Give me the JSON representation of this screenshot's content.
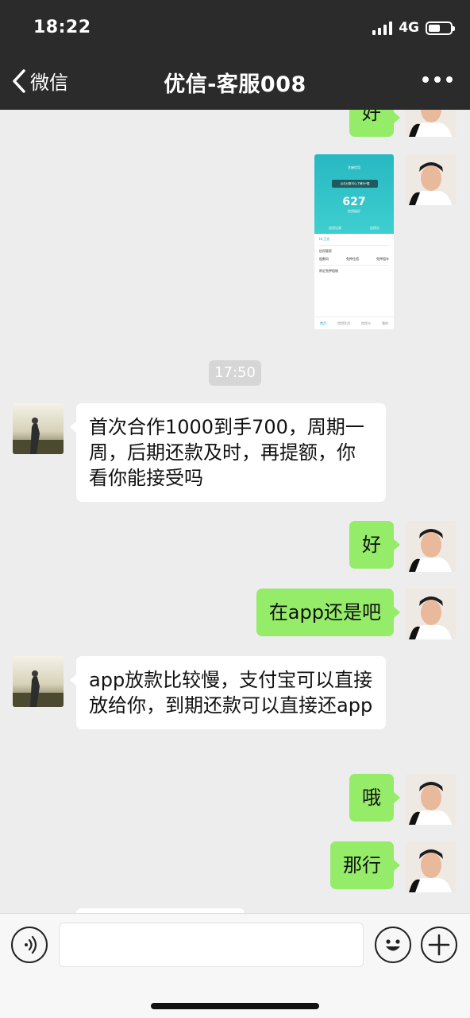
{
  "status_bar": {
    "time": "18:22",
    "network": "4G",
    "battery_level": 0.55
  },
  "nav": {
    "back_label": "微信",
    "title": "优信-客服008"
  },
  "messages": [
    {
      "side": "out",
      "type": "text",
      "text": "好"
    },
    {
      "side": "out",
      "type": "image",
      "screenshot": {
        "nav_title": "芝麻信用",
        "tip": "点击分数可以了解分*据",
        "score": "627",
        "score_label": "信用极好",
        "tab_left": "信用记录",
        "tab_right": "信用分",
        "greeting": "Hi,王先",
        "section": "信用管家",
        "items": [
          "租数码",
          "免押住宿",
          "免押租车"
        ],
        "promo": "附近免押租物",
        "footer": [
          "首页",
          "信用生活",
          "信用卡",
          "我的"
        ]
      }
    },
    {
      "type": "time",
      "text": "17:50"
    },
    {
      "side": "in",
      "type": "text",
      "text": "首次合作1000到手700，周期一周，后期还款及时，再提额，你看你能接受吗"
    },
    {
      "side": "out",
      "type": "text",
      "text": "好"
    },
    {
      "side": "out",
      "type": "text",
      "text": "在app还是吧"
    },
    {
      "side": "in",
      "type": "text",
      "text": "app放款比较慢，支付宝可以直接放给你，到期还款可以直接还app"
    },
    {
      "side": "out",
      "type": "text",
      "text": "哦"
    },
    {
      "side": "out",
      "type": "text",
      "text": "那行"
    }
  ],
  "input": {
    "value": ""
  },
  "colors": {
    "header_bg": "#2b2b2b",
    "chat_bg": "#ededed",
    "outgoing_bubble": "#95ec69",
    "incoming_bubble": "#ffffff"
  },
  "icons": [
    "back-chevron-icon",
    "more-icon",
    "voice-icon",
    "emoji-icon",
    "plus-icon"
  ]
}
